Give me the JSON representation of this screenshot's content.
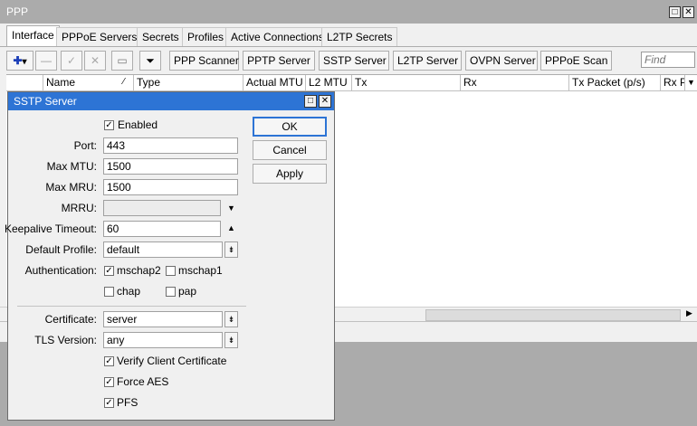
{
  "window": {
    "title": "PPP",
    "restore_icon": "□",
    "close_icon": "✕"
  },
  "tabs": [
    "Interface",
    "PPPoE Servers",
    "Secrets",
    "Profiles",
    "Active Connections",
    "L2TP Secrets"
  ],
  "toolbar": {
    "add_icon": "✚",
    "dropdown_icon": "▾",
    "remove_icon": "—",
    "enable_icon": "✓",
    "disable_icon": "✕",
    "comment_icon": "▭",
    "filter_icon": "⏷",
    "buttons": [
      "PPP Scanner",
      "PPTP Server",
      "SSTP Server",
      "L2TP Server",
      "OVPN Server",
      "PPPoE Scan"
    ],
    "find_placeholder": "Find"
  },
  "table": {
    "columns": [
      "Name",
      "Type",
      "Actual MTU",
      "L2 MTU",
      "Tx",
      "Rx",
      "Tx Packet (p/s)",
      "Rx Pa"
    ],
    "sort_icon": "⁄",
    "menu_icon": "▼",
    "scroll_right_icon": "▶"
  },
  "dialog": {
    "title": "SSTP Server",
    "restore_icon": "□",
    "close_icon": "✕",
    "enabled_label": "Enabled",
    "enabled": true,
    "port_label": "Port:",
    "port": "443",
    "max_mtu_label": "Max MTU:",
    "max_mtu": "1500",
    "max_mru_label": "Max MRU:",
    "max_mru": "1500",
    "mrru_label": "MRRU:",
    "mrru": "",
    "keepalive_label": "Keepalive Timeout:",
    "keepalive": "60",
    "default_profile_label": "Default Profile:",
    "default_profile": "default",
    "authentication_label": "Authentication:",
    "auth": [
      {
        "label": "mschap2",
        "checked": true
      },
      {
        "label": "mschap1",
        "checked": false
      },
      {
        "label": "chap",
        "checked": false
      },
      {
        "label": "pap",
        "checked": false
      }
    ],
    "certificate_label": "Certificate:",
    "certificate": "server",
    "tls_version_label": "TLS Version:",
    "tls_version": "any",
    "verify_client_cert_label": "Verify Client Certificate",
    "verify_client_cert": true,
    "force_aes_label": "Force AES",
    "force_aes": true,
    "pfs_label": "PFS",
    "pfs": true,
    "ok_label": "OK",
    "cancel_label": "Cancel",
    "apply_label": "Apply",
    "check_mark": "✓",
    "down_triangle": "▼",
    "up_triangle": "▲",
    "combo_icon": "⇟"
  }
}
